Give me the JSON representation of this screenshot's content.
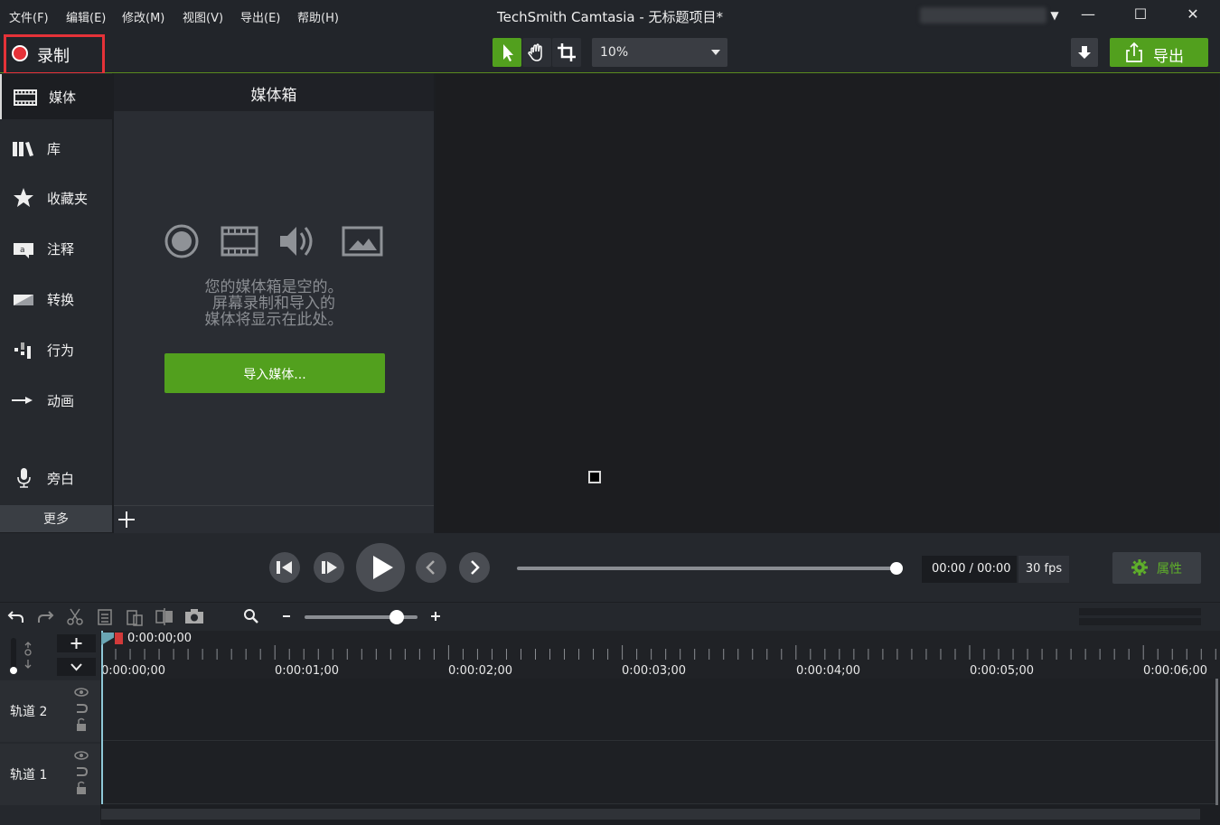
{
  "menu": {
    "file": "文件(F)",
    "edit": "编辑(E)",
    "modify": "修改(M)",
    "view": "视图(V)",
    "export": "导出(E)",
    "help": "帮助(H)"
  },
  "title": "TechSmith Camtasia - 无标题项目*",
  "window_controls": {
    "minimize": "—",
    "maximize": "☐",
    "close": "✕"
  },
  "toolbar": {
    "record_label": "录制",
    "zoom_value": "10%",
    "export_label": "导出"
  },
  "sidebar": {
    "items": [
      {
        "label": "媒体",
        "icon": "film-icon"
      },
      {
        "label": "库",
        "icon": "library-icon"
      },
      {
        "label": "收藏夹",
        "icon": "star-icon"
      },
      {
        "label": "注释",
        "icon": "annotation-icon"
      },
      {
        "label": "转换",
        "icon": "transition-icon"
      },
      {
        "label": "行为",
        "icon": "behavior-icon"
      },
      {
        "label": "动画",
        "icon": "animation-icon"
      },
      {
        "label": "旁白",
        "icon": "microphone-icon"
      }
    ],
    "more_label": "更多"
  },
  "media_bin": {
    "title": "媒体箱",
    "empty_line1": "您的媒体箱是空的。",
    "empty_line2": "屏幕录制和导入的",
    "empty_line3": "媒体将显示在此处。",
    "import_label": "导入媒体..."
  },
  "playback": {
    "time": "00:00 / 00:00",
    "fps": "30 fps",
    "properties_label": "属性"
  },
  "timeline": {
    "playhead_time": "0:00:00;00",
    "ticks": [
      "0:00:00;00",
      "0:00:01;00",
      "0:00:02;00",
      "0:00:03;00",
      "0:00:04;00",
      "0:00:05;00",
      "0:00:06;00"
    ],
    "tracks": [
      "轨道 2",
      "轨道 1"
    ]
  },
  "colors": {
    "accent_green": "#52a01e",
    "record_red": "#e53238",
    "background": "#1c1e22"
  }
}
